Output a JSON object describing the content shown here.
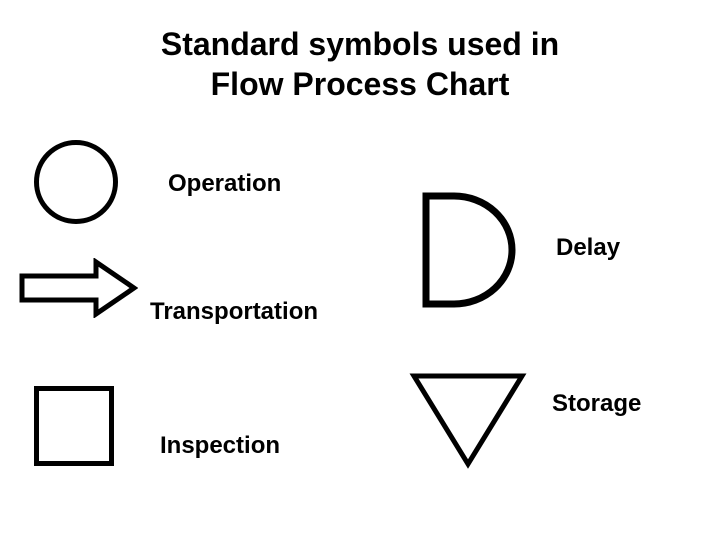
{
  "title_line1": "Standard symbols used in",
  "title_line2": "Flow Process Chart",
  "symbols": {
    "operation": {
      "label": "Operation",
      "shape": "circle"
    },
    "transportation": {
      "label": "Transportation",
      "shape": "arrow"
    },
    "inspection": {
      "label": "Inspection",
      "shape": "square"
    },
    "delay": {
      "label": "Delay",
      "shape": "half-ellipse"
    },
    "storage": {
      "label": "Storage",
      "shape": "inverted-triangle"
    }
  }
}
